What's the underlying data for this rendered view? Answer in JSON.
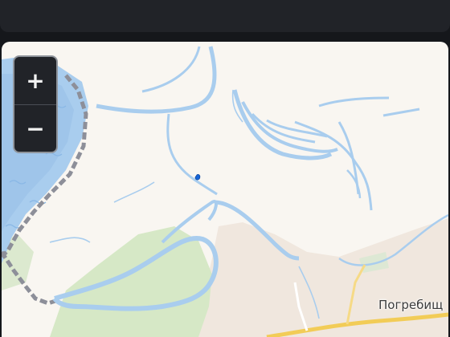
{
  "map": {
    "zoom_in_label": "+",
    "zoom_out_label": "−",
    "place_label": "Погребищ",
    "colors": {
      "land": "#f9f6f1",
      "water": "#a9cdee",
      "water_dark": "#8ab8e6",
      "forest": "#d6e8c6",
      "urban": "#f0e7de",
      "road": "#f2cc57",
      "border": "#8d8f99",
      "marker": "#1565d8"
    },
    "icons": [
      "zoom-in-icon",
      "zoom-out-icon",
      "location-marker-icon"
    ]
  }
}
